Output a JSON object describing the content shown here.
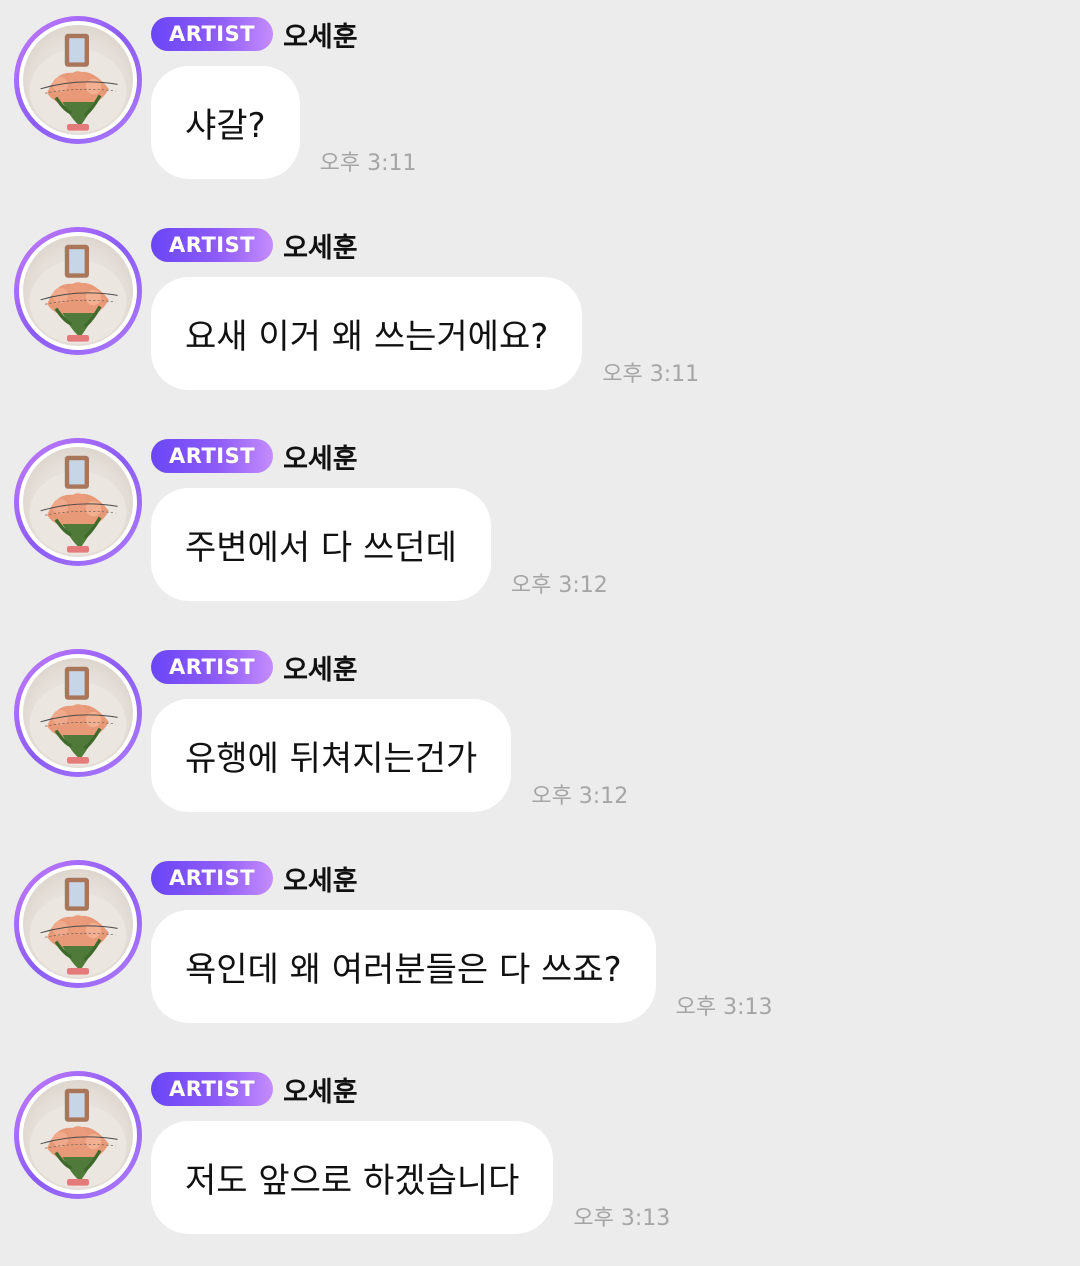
{
  "messages": [
    {
      "badge": "ARTIST",
      "sender": "오세훈",
      "text": "샤갈?",
      "time": "오후 3:11"
    },
    {
      "badge": "ARTIST",
      "sender": "오세훈",
      "text": "요새 이거 왜 쓰는거에요?",
      "time": "오후 3:11"
    },
    {
      "badge": "ARTIST",
      "sender": "오세훈",
      "text": "주변에서 다 쓰던데",
      "time": "오후 3:12"
    },
    {
      "badge": "ARTIST",
      "sender": "오세훈",
      "text": "유행에 뒤쳐지는건가",
      "time": "오후 3:12"
    },
    {
      "badge": "ARTIST",
      "sender": "오세훈",
      "text": "욕인데 왜 여러분들은 다 쓰죠?",
      "time": "오후 3:13"
    },
    {
      "badge": "ARTIST",
      "sender": "오세훈",
      "text": "저도 앞으로 하겠습니다",
      "time": "오후 3:13"
    }
  ],
  "avatar_icon": "profile-photo-flower-bouquet",
  "colors": {
    "background": "#ececec",
    "bubble": "#ffffff",
    "badge_start": "#6a46f6",
    "badge_end": "#c48cfb",
    "timestamp": "#a5a5a5"
  }
}
